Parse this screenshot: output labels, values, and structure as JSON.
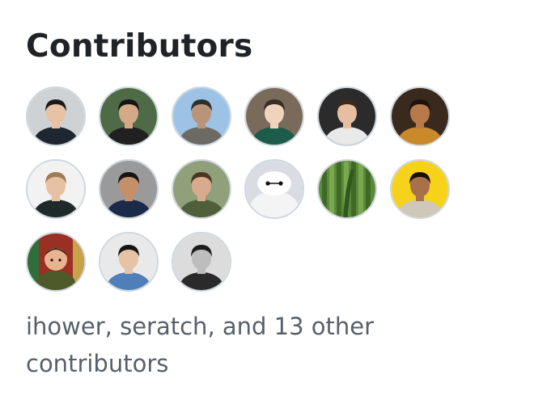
{
  "contributors": {
    "heading": "Contributors",
    "avatars": [
      {
        "icon": "avatar-photo-icon",
        "bg": "#cfd2d4",
        "skin": "#e7c2a4",
        "hair": "#1a1a1a",
        "shirt": "#1e2630"
      },
      {
        "icon": "avatar-photo-icon",
        "bg": "#4f6a46",
        "skin": "#d4a987",
        "hair": "#141414",
        "shirt": "#202020"
      },
      {
        "icon": "avatar-photo-icon",
        "bg": "#9cc3e6",
        "skin": "#b99478",
        "hair": "#2e2e2e",
        "shirt": "#6d6a64"
      },
      {
        "icon": "avatar-photo-icon",
        "bg": "#7a6a5a",
        "skin": "#f0d3bd",
        "hair": "#3a2d22",
        "shirt": "#1d5b4a"
      },
      {
        "icon": "avatar-photo-icon",
        "bg": "#2b2b2b",
        "skin": "#e6bfa3",
        "hair": "#3b2a1e",
        "shirt": "#e9e9e9"
      },
      {
        "icon": "avatar-photo-icon",
        "bg": "#3a2a1e",
        "skin": "#b87a4b",
        "hair": "#1d130c",
        "shirt": "#c98b2a"
      },
      {
        "icon": "avatar-photo-icon",
        "bg": "#f2f2f2",
        "skin": "#e8c0a2",
        "hair": "#a07a55",
        "shirt": "#1f2a2a"
      },
      {
        "icon": "avatar-photo-icon",
        "bg": "#9a9a9a",
        "skin": "#c4906a",
        "hair": "#151515",
        "shirt": "#1c2a4a"
      },
      {
        "icon": "avatar-photo-icon",
        "bg": "#8fa07a",
        "skin": "#d9ab8c",
        "hair": "#4a3424",
        "shirt": "#4f5f3a"
      },
      {
        "icon": "avatar-robot-icon",
        "bg": "#d9dde3",
        "skin": "#ffffff",
        "hair": "#ffffff",
        "shirt": "#f4f4f4"
      },
      {
        "icon": "avatar-cactus-icon",
        "bg": "#5d8a3a",
        "skin": "#4d7a30",
        "hair": "#7aa84e",
        "shirt": "#3e6a26"
      },
      {
        "icon": "avatar-photo-icon",
        "bg": "#f7d21a",
        "skin": "#a8714a",
        "hair": "#1a1008",
        "shirt": "#cfc7b8"
      },
      {
        "icon": "avatar-cartoon-icon",
        "bg": "#9a2f24",
        "skin": "#e8b48f",
        "hair": "#2d1a10",
        "shirt": "#4e5a2a"
      },
      {
        "icon": "avatar-photo-icon",
        "bg": "#e9e9e9",
        "skin": "#e6c2a6",
        "hair": "#141414",
        "shirt": "#4f7fb8"
      },
      {
        "icon": "avatar-photo-icon",
        "bg": "#dcdcdc",
        "skin": "#bdbdbd",
        "hair": "#1c1c1c",
        "shirt": "#2a2a2a"
      }
    ],
    "summary": "ihower, seratch, and 13 other contributors"
  }
}
